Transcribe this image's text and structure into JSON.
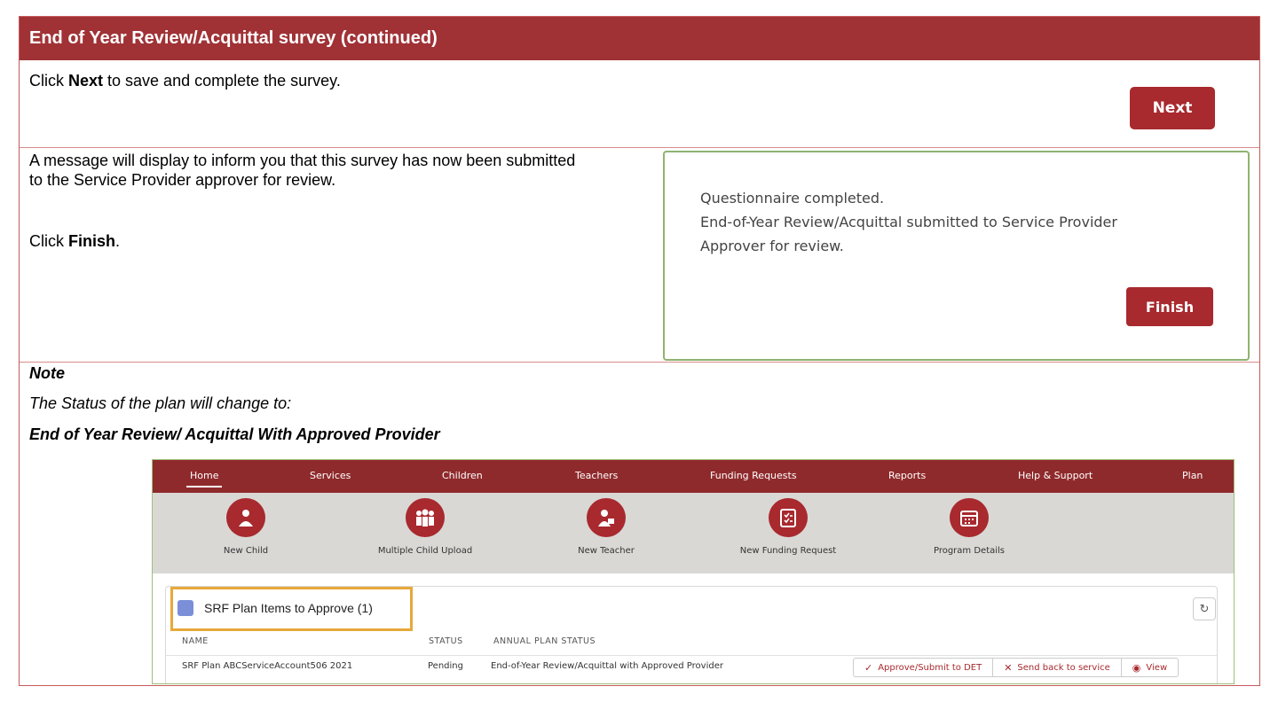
{
  "header": {
    "title": "End of Year Review/Acquittal survey (continued)"
  },
  "step1": {
    "text_prefix": "Click ",
    "text_bold": "Next",
    "text_suffix": " to save and complete the survey.",
    "next_button": "Next"
  },
  "step2": {
    "line1": "A message will display to inform you that this survey has now been submitted",
    "line2": "to the Service Provider approver for review.",
    "click_prefix": "Click ",
    "click_bold": "Finish",
    "click_suffix": ".",
    "dialog": {
      "line1": "Questionnaire completed.",
      "line2": "End-of-Year Review/Acquittal submitted to Service Provider",
      "line3": "Approver for review.",
      "finish_button": "Finish"
    }
  },
  "note": {
    "label": "Note",
    "text": "The Status of the plan will change to:",
    "status": "End of Year Review/ Acquittal With Approved Provider"
  },
  "app": {
    "nav": [
      "Home",
      "Services",
      "Children",
      "Teachers",
      "Funding Requests",
      "Reports",
      "Help & Support",
      "Plan"
    ],
    "actions": [
      {
        "label": "New Child",
        "icon": "child-icon"
      },
      {
        "label": "Multiple Child Upload",
        "icon": "group-icon"
      },
      {
        "label": "New Teacher",
        "icon": "teacher-icon"
      },
      {
        "label": "New Funding Request",
        "icon": "clipboard-icon"
      },
      {
        "label": "Program Details",
        "icon": "calendar-icon"
      }
    ],
    "list": {
      "title": "SRF Plan Items to Approve (1)",
      "columns": [
        "NAME",
        "STATUS",
        "ANNUAL PLAN STATUS"
      ],
      "row": {
        "name": "SRF Plan ABCServiceAccount506 2021",
        "status": "Pending",
        "annual_status": "End-of-Year Review/Acquittal with Approved Provider"
      },
      "buttons": {
        "approve": "Approve/Submit to DET",
        "send_back": "Send back to service",
        "view": "View"
      }
    },
    "colors": {
      "brand": "#a8292e",
      "nav": "#8f2a2c",
      "highlight": "#e6a93a"
    }
  }
}
